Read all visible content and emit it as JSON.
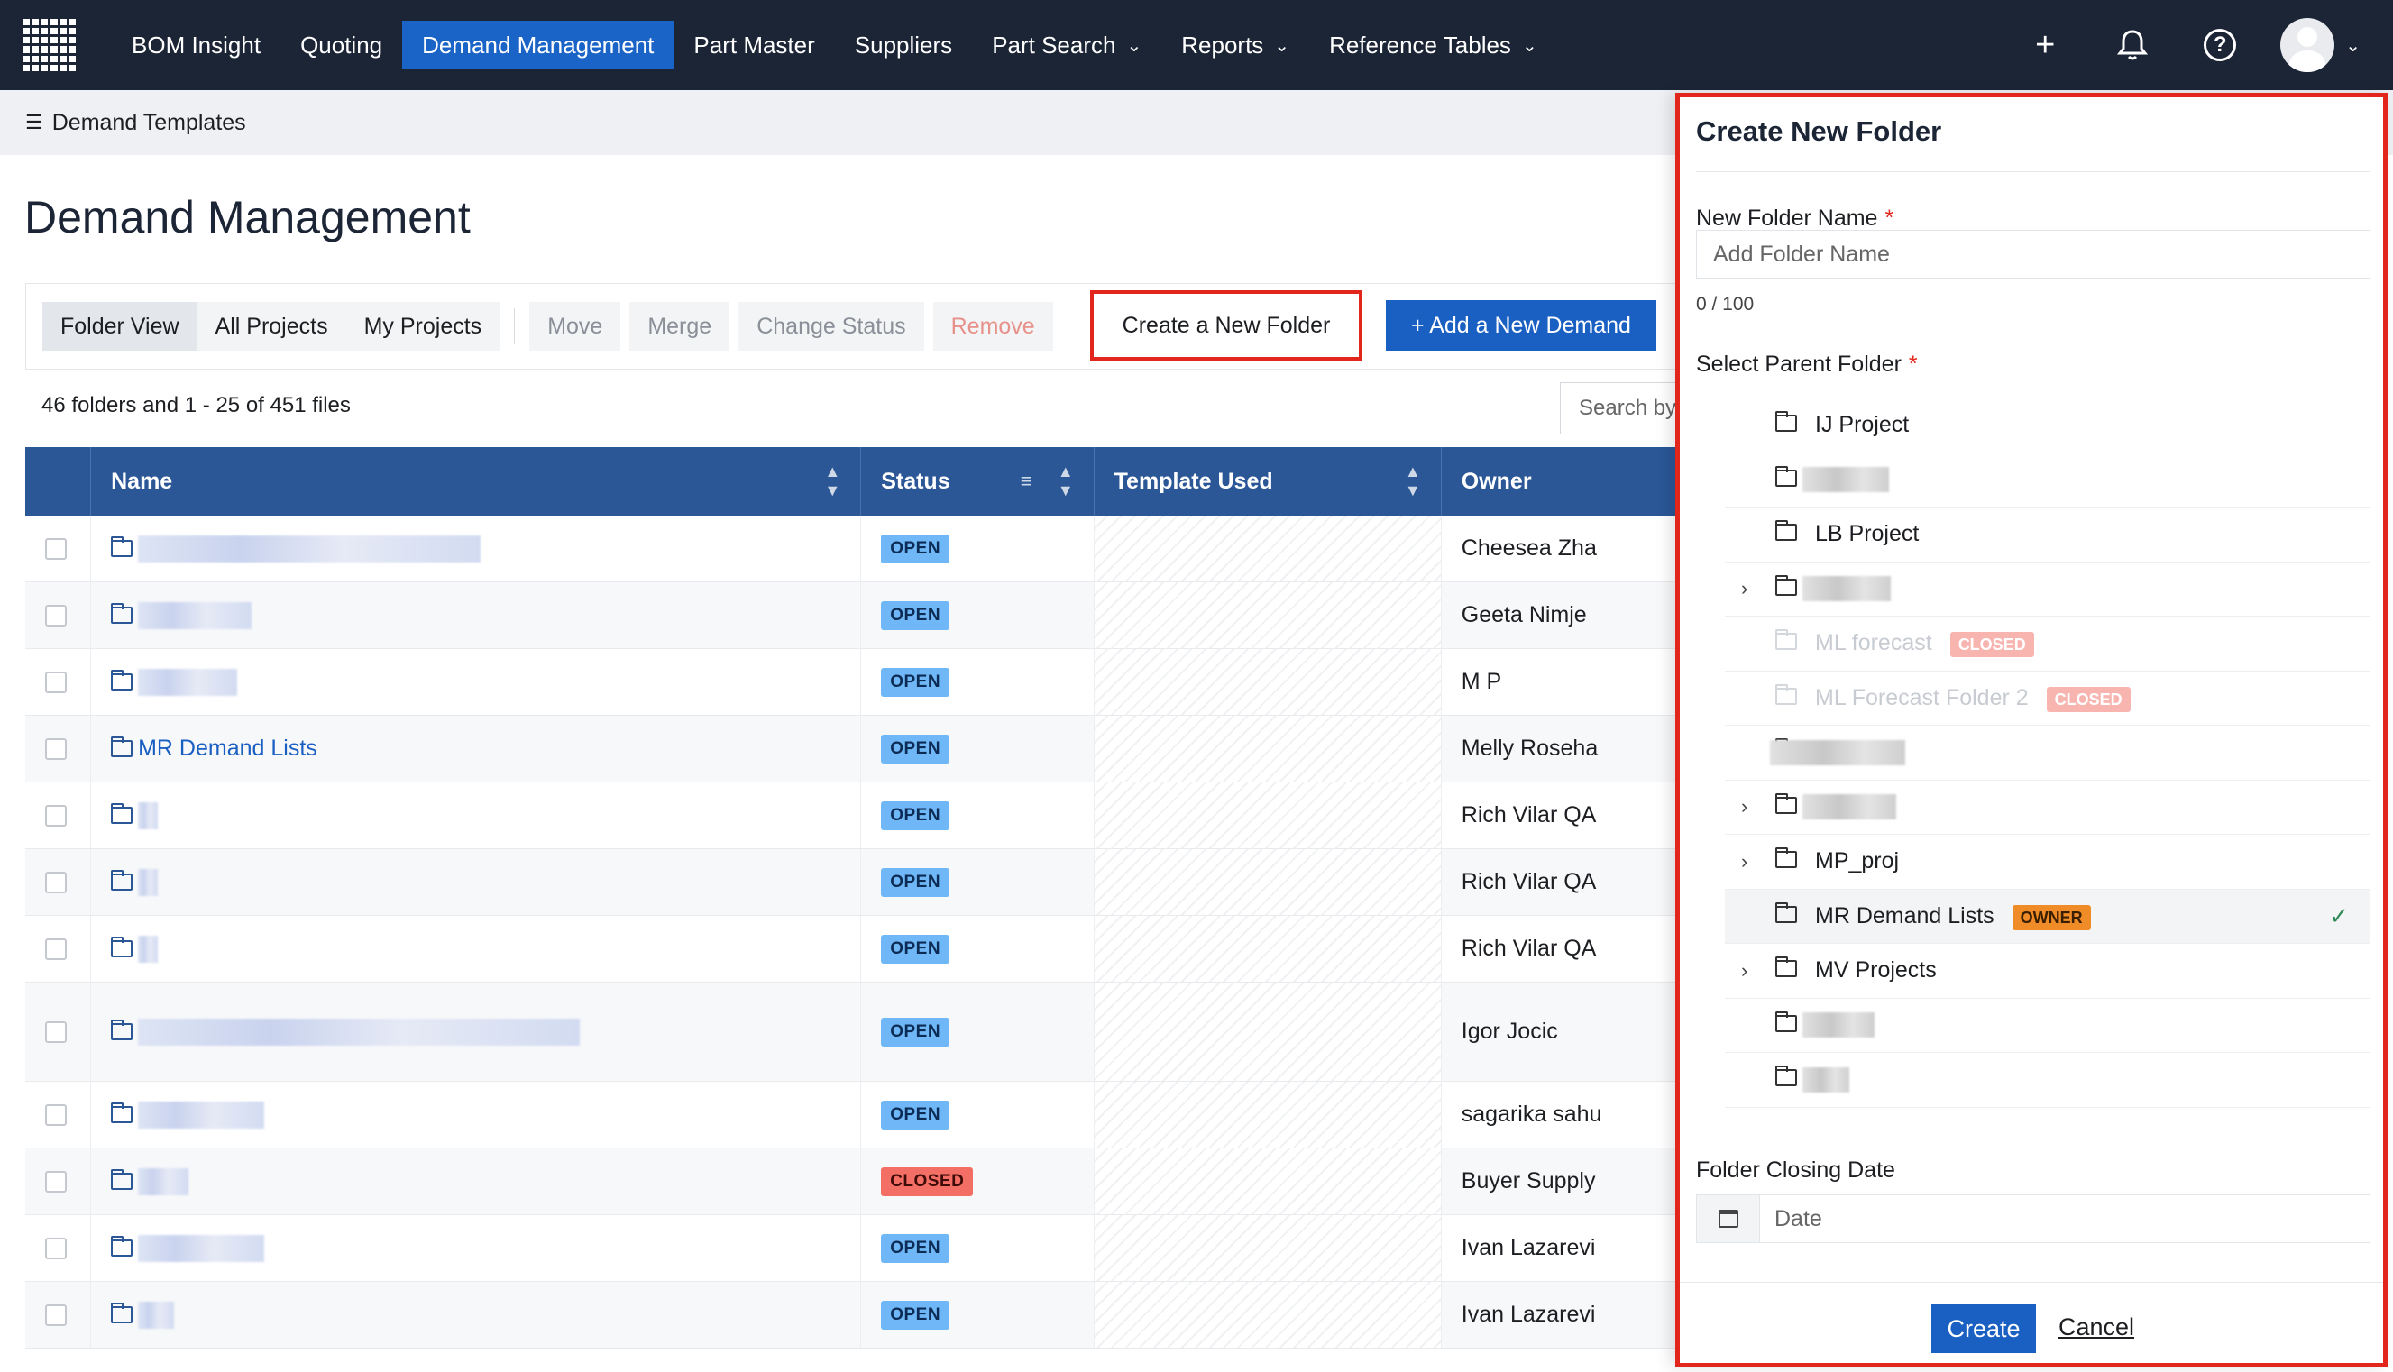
{
  "nav": {
    "items": [
      {
        "label": "BOM Insight"
      },
      {
        "label": "Quoting"
      },
      {
        "label": "Demand Management",
        "active": true
      },
      {
        "label": "Part Master"
      },
      {
        "label": "Suppliers"
      },
      {
        "label": "Part Search",
        "dropdown": true
      },
      {
        "label": "Reports",
        "dropdown": true
      },
      {
        "label": "Reference Tables",
        "dropdown": true
      }
    ],
    "icons": [
      "plus-icon",
      "bell-icon",
      "help-icon",
      "avatar"
    ],
    "colors": {
      "bar": "#1c2536",
      "active": "#1a63c7"
    }
  },
  "breadcrumb": {
    "label": "Demand Templates"
  },
  "page": {
    "title": "Demand Management"
  },
  "toolbar": {
    "folder_view": "Folder View",
    "all_projects": "All Projects",
    "my_projects": "My Projects",
    "move": "Move",
    "merge": "Merge",
    "change_status": "Change Status",
    "remove": "Remove",
    "create_folder": "Create a New Folder",
    "add_demand": "+ Add a New Demand"
  },
  "summary": {
    "count": "46 folders and 1 - 25 of 451 files",
    "search_placeholder": "Search by"
  },
  "table": {
    "headers": {
      "name": "Name",
      "status": "Status",
      "template": "Template Used",
      "owner": "Owner"
    },
    "rows": [
      {
        "name": "",
        "status": "OPEN",
        "owner": "Cheesea Zha"
      },
      {
        "name": "",
        "status": "OPEN",
        "owner": "Geeta Nimje"
      },
      {
        "name": "",
        "status": "OPEN",
        "owner": "M P"
      },
      {
        "name": "MR Demand Lists",
        "status": "OPEN",
        "owner": "Melly Roseha"
      },
      {
        "name": "",
        "status": "OPEN",
        "owner": "Rich Vilar QA"
      },
      {
        "name": "",
        "status": "OPEN",
        "owner": "Rich Vilar QA"
      },
      {
        "name": "",
        "status": "OPEN",
        "owner": "Rich Vilar QA"
      },
      {
        "name": "",
        "status": "OPEN",
        "owner": "Igor Jocic"
      },
      {
        "name": "",
        "status": "OPEN",
        "owner": "sagarika sahu"
      },
      {
        "name": "",
        "status": "CLOSED",
        "owner": "Buyer Supply"
      },
      {
        "name": "",
        "status": "OPEN",
        "owner": "Ivan Lazarevi"
      },
      {
        "name": "",
        "status": "OPEN",
        "owner": "Ivan Lazarevi"
      }
    ]
  },
  "panel": {
    "title": "Create New Folder",
    "name_label": "New Folder Name",
    "name_placeholder": "Add Folder Name",
    "counter": "0 / 100",
    "parent_label": "Select Parent Folder",
    "tree": [
      {
        "label": "IJ Project"
      },
      {
        "label": ""
      },
      {
        "label": "LB Project"
      },
      {
        "label": "",
        "expandable": true
      },
      {
        "label": "ML forecast",
        "badge": "CLOSED",
        "disabled": true
      },
      {
        "label": "ML Forecast Folder 2",
        "badge": "CLOSED",
        "disabled": true
      },
      {
        "label": ""
      },
      {
        "label": "",
        "expandable": true
      },
      {
        "label": "MP_proj",
        "expandable": true
      },
      {
        "label": "MR Demand Lists",
        "badge": "OWNER",
        "selected": true
      },
      {
        "label": "MV Projects",
        "expandable": true
      },
      {
        "label": ""
      },
      {
        "label": ""
      }
    ],
    "date_label": "Folder Closing Date",
    "date_placeholder": "Date",
    "create": "Create",
    "cancel": "Cancel"
  }
}
